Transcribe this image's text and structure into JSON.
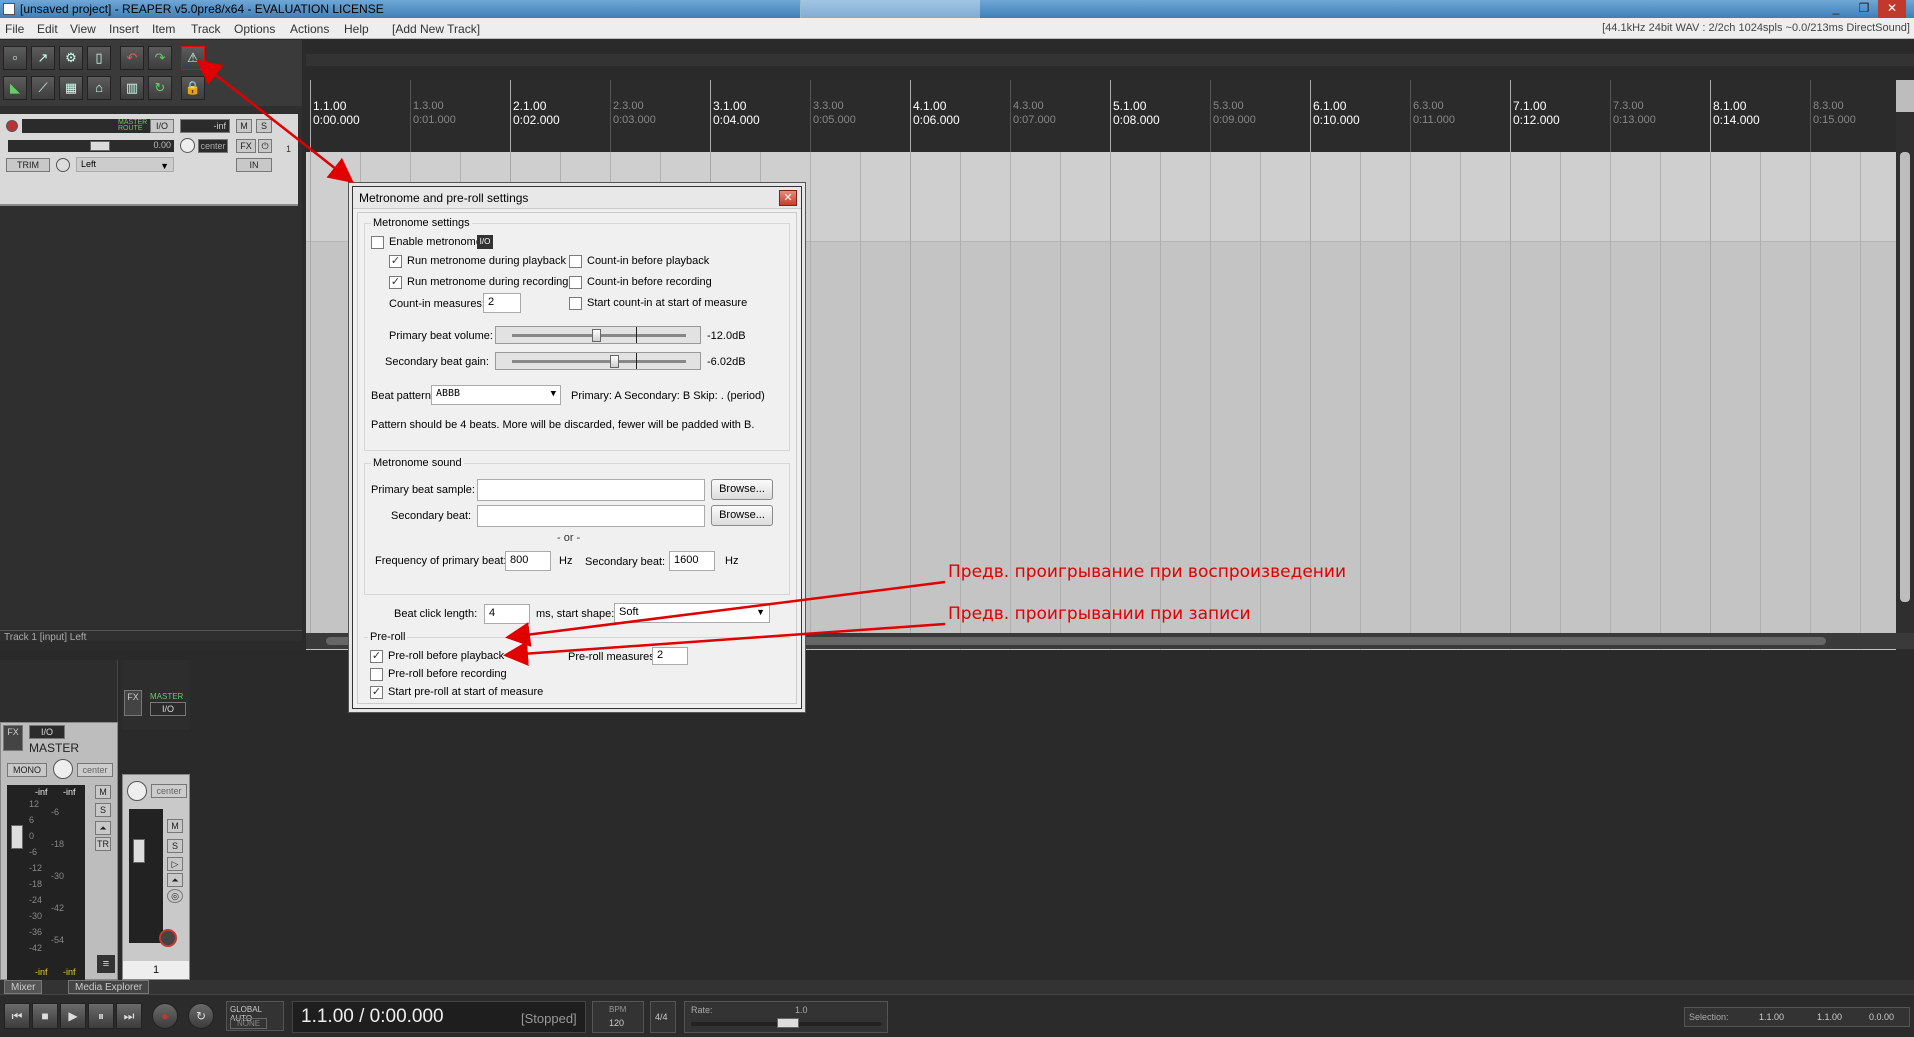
{
  "window": {
    "title": "[unsaved project] - REAPER v5.0pre8/x64 - EVALUATION LICENSE",
    "controls": [
      "_",
      "❐",
      "✕"
    ]
  },
  "menu": {
    "items": [
      "File",
      "Edit",
      "View",
      "Insert",
      "Item",
      "Track",
      "Options",
      "Actions",
      "Help",
      "[Add New Track]"
    ],
    "status": "[44.1kHz 24bit WAV : 2/2ch 1024spls ~0.0/213ms DirectSound]"
  },
  "toolbar": {
    "icons": [
      "new-project-icon",
      "open-project-icon",
      "save-project-icon",
      "project-settings-icon",
      "undo-icon",
      "redo-icon",
      "metronome-icon",
      "snap-icon",
      "ripple-icon",
      "grid-icon",
      "lock-icon",
      "loop-icon",
      "envelope-icon",
      "auto-crossfade-icon"
    ]
  },
  "track": {
    "name_badges": [
      "MASTER",
      "ROUTE"
    ],
    "io": "I/O",
    "volume": "-inf",
    "m": "M",
    "s": "S",
    "pan_value": "0.00",
    "pan": "center",
    "fx": "FX",
    "trim": "TRIM",
    "input": "Left",
    "in": "IN",
    "number": "1",
    "footer": "Track 1 [input] Left"
  },
  "ruler": {
    "major": [
      {
        "bar": "1.1.00",
        "time": "0:00.000"
      },
      {
        "bar": "2.1.00",
        "time": "0:02.000"
      },
      {
        "bar": "3.1.00",
        "time": "0:04.000"
      },
      {
        "bar": "4.1.00",
        "time": "0:06.000"
      },
      {
        "bar": "5.1.00",
        "time": "0:08.000"
      },
      {
        "bar": "6.1.00",
        "time": "0:10.000"
      },
      {
        "bar": "7.1.00",
        "time": "0:12.000"
      },
      {
        "bar": "8.1.00",
        "time": "0:14.000"
      }
    ],
    "minor": [
      {
        "bar": "1.3.00",
        "time": "0:01.000"
      },
      {
        "bar": "2.3.00",
        "time": "0:03.000"
      },
      {
        "bar": "3.3.00",
        "time": "0:05.000"
      },
      {
        "bar": "4.3.00",
        "time": "0:07.000"
      },
      {
        "bar": "5.3.00",
        "time": "0:09.000"
      },
      {
        "bar": "6.3.00",
        "time": "0:11.000"
      },
      {
        "bar": "7.3.00",
        "time": "0:13.000"
      },
      {
        "bar": "8.3.00",
        "time": "0:15.000"
      }
    ]
  },
  "dialog": {
    "title": "Metronome and pre-roll settings",
    "close": "✕",
    "metronome_settings": {
      "group_label": "Metronome settings",
      "enable_metronome": "Enable metronome",
      "io": "I/O",
      "run_playback": "Run metronome during playback",
      "run_recording": "Run metronome during recording",
      "countin_playback": "Count-in before playback",
      "countin_recording": "Count-in before recording",
      "countin_measures_label": "Count-in measures:",
      "countin_measures": "2",
      "start_countin": "Start count-in at start of measure",
      "primary_volume_label": "Primary beat volume:",
      "primary_volume": "-12.0dB",
      "secondary_gain_label": "Secondary beat gain:",
      "secondary_gain": "-6.02dB",
      "beat_pattern_label": "Beat pattern:",
      "beat_pattern": "ABBB",
      "pattern_legend": "Primary: A   Secondary: B   Skip: . (period)",
      "pattern_note": "Pattern should be 4 beats. More will be discarded, fewer will be padded with B."
    },
    "metronome_sound": {
      "group_label": "Metronome sound",
      "primary_sample_label": "Primary beat sample:",
      "secondary_beat_label": "Secondary beat:",
      "browse": "Browse...",
      "or": "- or -",
      "freq_primary_label": "Frequency of primary beat:",
      "freq_primary": "800",
      "hz": "Hz",
      "secondary_beat_freq_label": "Secondary beat:",
      "secondary_freq": "1600",
      "click_length_label": "Beat click length:",
      "click_length": "4",
      "start_shape_label": "ms, start shape:",
      "start_shape": "Soft"
    },
    "preroll": {
      "group_label": "Pre-roll",
      "before_playback": "Pre-roll before playback",
      "measures_label": "Pre-roll measures:",
      "measures": "2",
      "before_recording": "Pre-roll before recording",
      "start_at_measure": "Start pre-roll at start of measure"
    }
  },
  "annotations": {
    "playback": "Предв. проигрывание при воспроизведении",
    "recording": "Предв. проигрывании при записи"
  },
  "mixer": {
    "master_label": "MASTER",
    "io": "I/O",
    "fx": "FX",
    "mono": "MONO",
    "pan": "center",
    "master_peak_l": "-inf",
    "master_peak_r": "-inf",
    "scale": [
      "12",
      "6",
      "0",
      "-6",
      "-12",
      "-18",
      "-24",
      "-30",
      "-36",
      "-42"
    ],
    "scale_mid": [
      "-6",
      "-18",
      "-30",
      "-42",
      "-54"
    ],
    "master_bottom_l": "-inf",
    "master_bottom_r": "-inf",
    "m": "M",
    "s": "S",
    "tr": "TR",
    "track_badge": "MASTER",
    "track_number": "1",
    "tabs": [
      "Mixer",
      "Media Explorer"
    ]
  },
  "transport": {
    "global_auto": "GLOBAL AUTO",
    "none": "NONE",
    "position": "1.1.00 / 0:00.000",
    "state": "[Stopped]",
    "bpm_label": "BPM",
    "bpm": "120",
    "time_sig": "4/4",
    "rate_label": "Rate:",
    "rate": "1.0",
    "selection_label": "Selection:",
    "sel_start": "1.1.00",
    "sel_end": "1.1.00",
    "sel_len": "0.0.00"
  },
  "checks": {
    "enable_metronome": false,
    "run_playback": true,
    "run_recording": true,
    "countin_playback": false,
    "countin_recording": false,
    "start_countin": false,
    "preroll_playback": true,
    "preroll_recording": false,
    "preroll_start_measure": true
  },
  "colors": {
    "annotation": "#e00000",
    "record": "#c0392b"
  }
}
